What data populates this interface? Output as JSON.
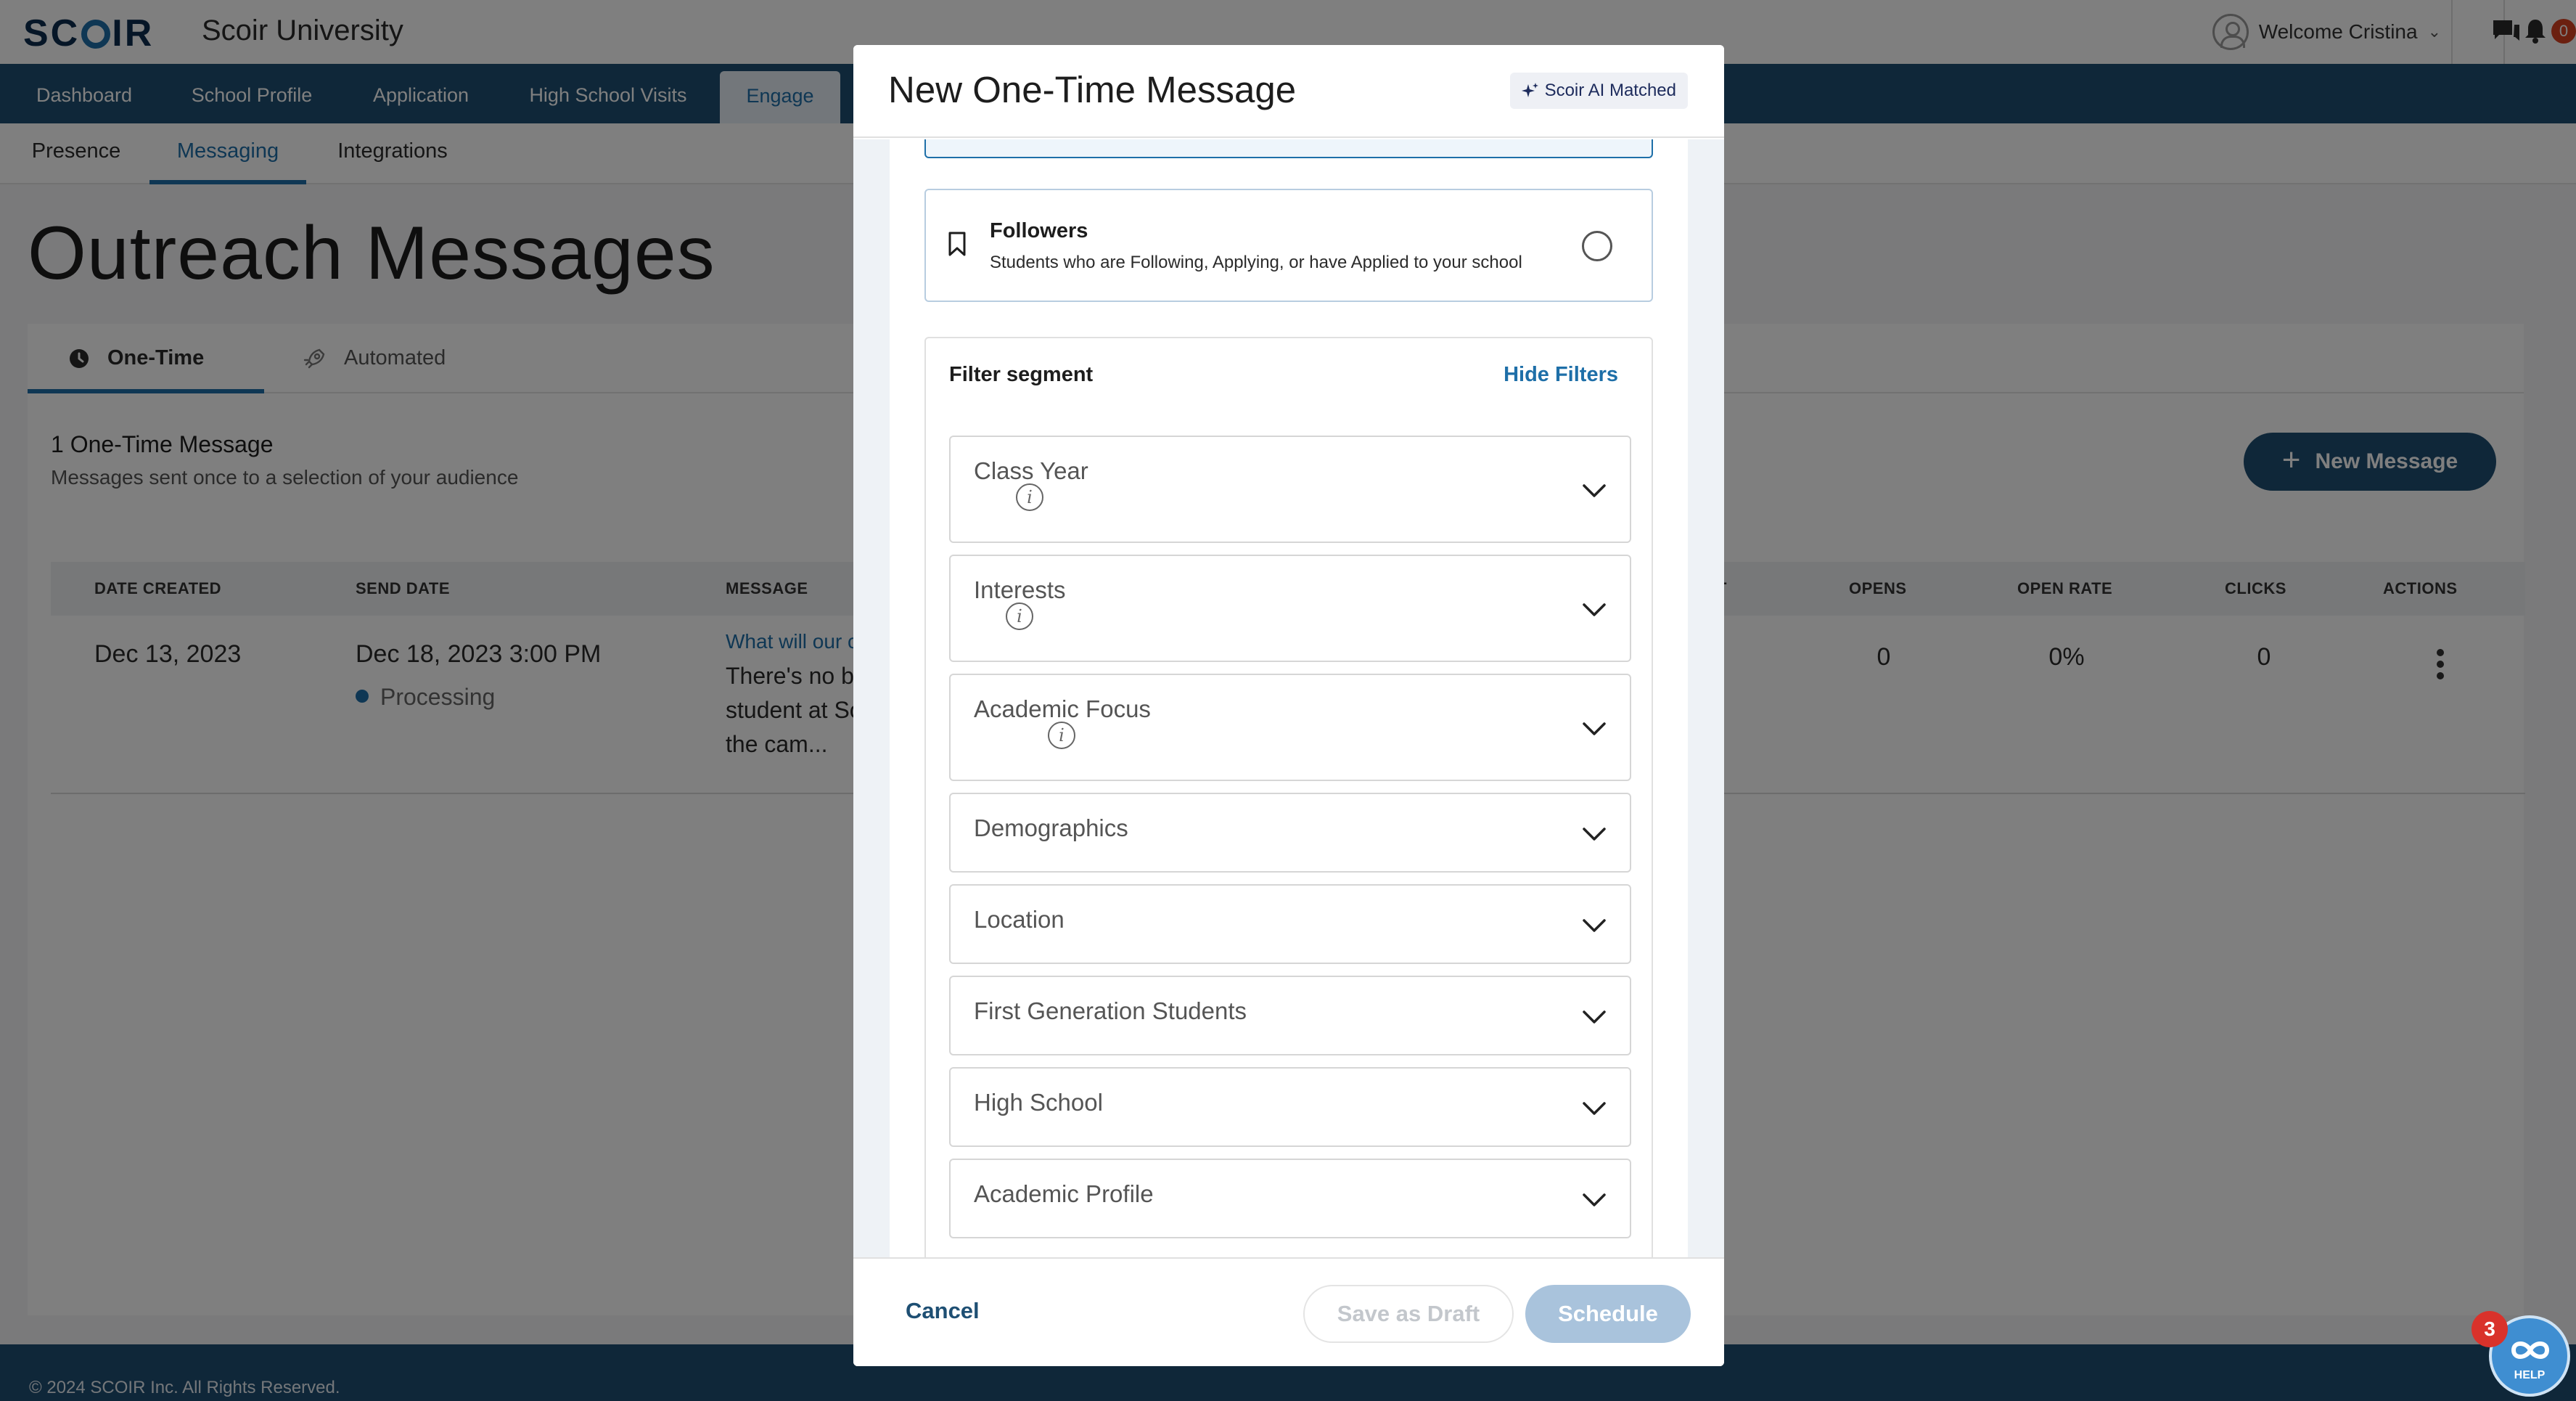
{
  "app": {
    "logo_text_before": "SC",
    "logo_text_after": "IR",
    "school_name": "Scoir University",
    "welcome_text": "Welcome Cristina",
    "notification_count": "0"
  },
  "main_nav": {
    "items": [
      {
        "label": "Dashboard"
      },
      {
        "label": "School Profile"
      },
      {
        "label": "Application"
      },
      {
        "label": "High School Visits"
      },
      {
        "label": "Engage"
      }
    ],
    "active": "Engage"
  },
  "sub_nav": {
    "items": [
      {
        "label": "Presence"
      },
      {
        "label": "Messaging"
      },
      {
        "label": "Integrations"
      }
    ],
    "active": "Messaging"
  },
  "page": {
    "title": "Outreach Messages",
    "tabs": [
      {
        "label": "One-Time"
      },
      {
        "label": "Automated"
      }
    ],
    "active_tab": "One-Time",
    "count_title": "1 One-Time Message",
    "count_subtitle": "Messages sent once to a selection of your audience",
    "new_message_label": "New Message"
  },
  "table": {
    "headers": [
      "DATE CREATED",
      "SEND DATE",
      "MESSAGE",
      "T",
      "OPENS",
      "OPEN RATE",
      "CLICKS",
      "ACTIONS"
    ],
    "rows": [
      {
        "date_created": "Dec 13, 2023",
        "send_date": "Dec 18, 2023 3:00 PM",
        "status": "Processing",
        "message_title": "What will our c",
        "message_preview": "There's no b student at So the cam...",
        "opens": "0",
        "open_rate": "0%",
        "clicks": "0"
      }
    ]
  },
  "footer": {
    "copyright": "© 2024 SCOIR Inc. All Rights Reserved."
  },
  "modal": {
    "title": "New One-Time Message",
    "ai_badge": "Scoir AI Matched",
    "option": {
      "title": "Followers",
      "subtitle": "Students who are Following, Applying, or have Applied to your school"
    },
    "filter": {
      "title": "Filter segment",
      "toggle_label": "Hide Filters",
      "dropdowns": [
        {
          "label": "Class Year"
        },
        {
          "label": "Interests"
        },
        {
          "label": "Academic Focus"
        },
        {
          "label": "Demographics"
        },
        {
          "label": "Location"
        },
        {
          "label": "First Generation Students"
        },
        {
          "label": "High School"
        },
        {
          "label": "Academic Profile"
        }
      ]
    },
    "footer": {
      "cancel_label": "Cancel",
      "draft_label": "Save as Draft",
      "schedule_label": "Schedule"
    }
  },
  "help": {
    "label": "HELP",
    "badge_count": "3"
  },
  "colors": {
    "brand_navy": "#1e4f73",
    "accent_blue": "#1e6fa8",
    "notification_red": "#d64020"
  }
}
